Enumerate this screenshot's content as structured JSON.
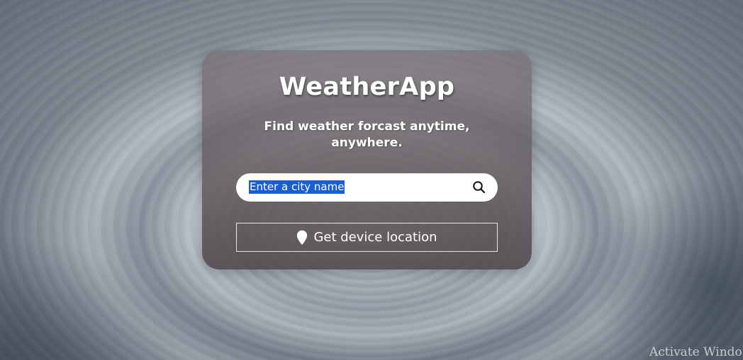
{
  "app": {
    "title": "WeatherApp",
    "subtitle": "Find weather forcast anytime, anywhere."
  },
  "search": {
    "placeholder": "Enter a city name",
    "selected_text": "Enter a city name",
    "icon": "search-icon"
  },
  "location_button": {
    "label": "Get device location",
    "icon": "location-pin-icon"
  },
  "watermark": {
    "text": "Activate Windo"
  },
  "colors": {
    "card_top": "#787074",
    "card_bottom": "#4e4448",
    "selection_highlight": "#1a5fd1",
    "text": "#ffffff"
  }
}
